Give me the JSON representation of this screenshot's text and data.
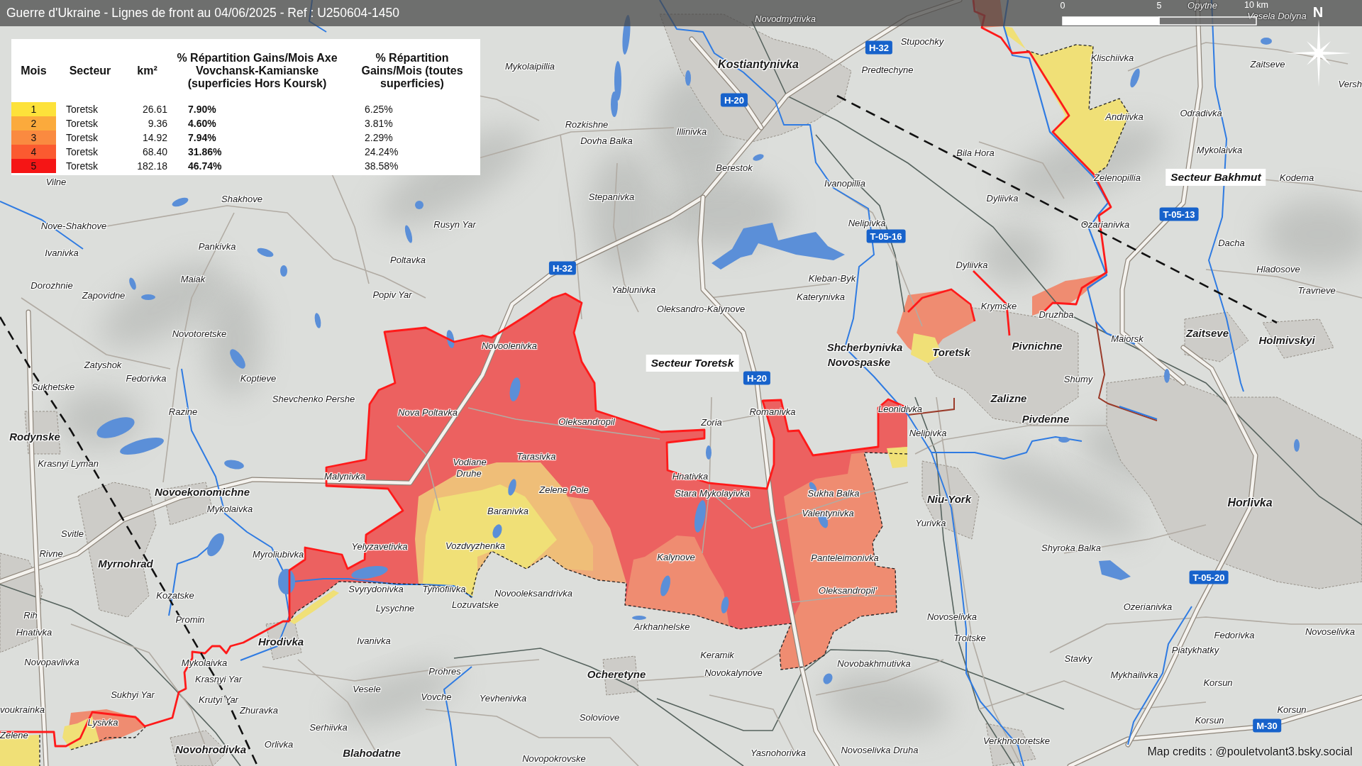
{
  "header": {
    "title": "Guerre d'Ukraine - Lignes de front au 04/06/2025 - Ref : U250604-1450"
  },
  "scale_bar": {
    "ticks": [
      "0",
      "5",
      "10 km"
    ]
  },
  "compass": {
    "label": "N"
  },
  "legend": {
    "columns": [
      "Mois",
      "Secteur",
      "km²",
      "% Répartition Gains/Mois Axe Vovchansk-Kamianske (superficies Hors Koursk)",
      "% Répartition Gains/Mois (toutes superficies)"
    ],
    "rows": [
      {
        "month": "1",
        "color": "#fde23a",
        "sector": "Toretsk",
        "area": "26.61",
        "share_axis": "7.90%",
        "share_all": "6.25%"
      },
      {
        "month": "2",
        "color": "#fbaa3c",
        "sector": "Toretsk",
        "area": "9.36",
        "share_axis": "4.60%",
        "share_all": "3.81%"
      },
      {
        "month": "3",
        "color": "#fa8a40",
        "sector": "Toretsk",
        "area": "14.92",
        "share_axis": "7.94%",
        "share_all": "2.29%"
      },
      {
        "month": "4",
        "color": "#fb5a30",
        "sector": "Toretsk",
        "area": "68.40",
        "share_axis": "31.86%",
        "share_all": "24.24%"
      },
      {
        "month": "5",
        "color": "#f51515",
        "sector": "Toretsk",
        "area": "182.18",
        "share_axis": "46.74%",
        "share_all": "38.58%"
      }
    ]
  },
  "sectors": [
    {
      "label": "Secteur Bakhmut"
    },
    {
      "label": "Secteur Toretsk"
    }
  ],
  "road_signs": [
    {
      "label": "H-32"
    },
    {
      "label": "H-20"
    },
    {
      "label": "T-05-13"
    },
    {
      "label": "T-05-16"
    },
    {
      "label": "H-32"
    },
    {
      "label": "H-20"
    },
    {
      "label": "T-05-20"
    },
    {
      "label": "M-30"
    }
  ],
  "places": [
    {
      "name": "Novodmytrivka",
      "kind": "village"
    },
    {
      "name": "Opytne",
      "kind": "village"
    },
    {
      "name": "Vesela Dolyna",
      "kind": "village"
    },
    {
      "name": "Stupochky",
      "kind": "village"
    },
    {
      "name": "Mykolaipillia",
      "kind": "village"
    },
    {
      "name": "Kostiantynivka",
      "kind": "city"
    },
    {
      "name": "Predtechyne",
      "kind": "village"
    },
    {
      "name": "Klischiivka",
      "kind": "village"
    },
    {
      "name": "Zaitseve",
      "kind": "village"
    },
    {
      "name": "Versh",
      "kind": "village"
    },
    {
      "name": "Andriivka",
      "kind": "village"
    },
    {
      "name": "Odradivka",
      "kind": "village"
    },
    {
      "name": "Rozkishne",
      "kind": "village"
    },
    {
      "name": "Dovha Balka",
      "kind": "village"
    },
    {
      "name": "Illinivka",
      "kind": "village"
    },
    {
      "name": "Bila Hora",
      "kind": "village"
    },
    {
      "name": "Mykolaivka",
      "kind": "village"
    },
    {
      "name": "Vilne",
      "kind": "village"
    },
    {
      "name": "Berestok",
      "kind": "village"
    },
    {
      "name": "Ivanopillia",
      "kind": "village"
    },
    {
      "name": "Zelenopillia",
      "kind": "village"
    },
    {
      "name": "Kodema",
      "kind": "village"
    },
    {
      "name": "Shakhove",
      "kind": "village"
    },
    {
      "name": "Stepanivka",
      "kind": "village"
    },
    {
      "name": "Dyliivka",
      "kind": "village"
    },
    {
      "name": "Nove-Shakhove",
      "kind": "village"
    },
    {
      "name": "Rusyn Yar",
      "kind": "village"
    },
    {
      "name": "Nelipivka",
      "kind": "village"
    },
    {
      "name": "Ozarianivka",
      "kind": "village"
    },
    {
      "name": "Ivanivka",
      "kind": "village"
    },
    {
      "name": "Pankivka",
      "kind": "village"
    },
    {
      "name": "Dacha",
      "kind": "village"
    },
    {
      "name": "Poltavka",
      "kind": "village"
    },
    {
      "name": "Dyliivka",
      "kind": "village"
    },
    {
      "name": "Hladosove",
      "kind": "village"
    },
    {
      "name": "Dorozhnie",
      "kind": "village"
    },
    {
      "name": "Maiak",
      "kind": "village"
    },
    {
      "name": "Kleban-Byk",
      "kind": "village"
    },
    {
      "name": "Zapovidne",
      "kind": "village"
    },
    {
      "name": "Popiv Yar",
      "kind": "village"
    },
    {
      "name": "Yablunivka",
      "kind": "village"
    },
    {
      "name": "Katerynivka",
      "kind": "village"
    },
    {
      "name": "Travneve",
      "kind": "village"
    },
    {
      "name": "Oleksandro-Kalynove",
      "kind": "village"
    },
    {
      "name": "Krymske",
      "kind": "village"
    },
    {
      "name": "Druzhba",
      "kind": "village"
    },
    {
      "name": "Novotoretske",
      "kind": "village"
    },
    {
      "name": "Novoolenivka",
      "kind": "village"
    },
    {
      "name": "Shcherbynivka",
      "kind": "town"
    },
    {
      "name": "Toretsk",
      "kind": "town"
    },
    {
      "name": "Pivnichne",
      "kind": "town"
    },
    {
      "name": "Maiorsk",
      "kind": "village"
    },
    {
      "name": "Zaitseve",
      "kind": "town"
    },
    {
      "name": "Holmivskyi",
      "kind": "town"
    },
    {
      "name": "Zatyshok",
      "kind": "village"
    },
    {
      "name": "Novospaske",
      "kind": "town"
    },
    {
      "name": "Sukhetske",
      "kind": "village"
    },
    {
      "name": "Fedorivka",
      "kind": "village"
    },
    {
      "name": "Koptieve",
      "kind": "village"
    },
    {
      "name": "Shumy",
      "kind": "village"
    },
    {
      "name": "Shevchenko Pershe",
      "kind": "village"
    },
    {
      "name": "Zalizne",
      "kind": "town"
    },
    {
      "name": "Razine",
      "kind": "village"
    },
    {
      "name": "Nova Poltavka",
      "kind": "village"
    },
    {
      "name": "Oleksandropil",
      "kind": "village"
    },
    {
      "name": "Zoria",
      "kind": "village"
    },
    {
      "name": "Romanivka",
      "kind": "village"
    },
    {
      "name": "Leonidivka",
      "kind": "village"
    },
    {
      "name": "Pivdenne",
      "kind": "town"
    },
    {
      "name": "Rodynske",
      "kind": "town"
    },
    {
      "name": "Nelipivka",
      "kind": "village"
    },
    {
      "name": "Krasnyi Lyman",
      "kind": "village"
    },
    {
      "name": "Vodiane",
      "kind": "village"
    },
    {
      "name": "Tarasivka",
      "kind": "village"
    },
    {
      "name": "Malynivka",
      "kind": "village"
    },
    {
      "name": "Druhe",
      "kind": "village"
    },
    {
      "name": "Hnativka",
      "kind": "village"
    },
    {
      "name": "Novoekonomichne",
      "kind": "town"
    },
    {
      "name": "Mykolaivka",
      "kind": "village"
    },
    {
      "name": "Baranivka",
      "kind": "village"
    },
    {
      "name": "Zelene Pole",
      "kind": "village"
    },
    {
      "name": "Stara Mykolayivka",
      "kind": "village"
    },
    {
      "name": "Sukha Balka",
      "kind": "village"
    },
    {
      "name": "Valentynivka",
      "kind": "village"
    },
    {
      "name": "Niu-York",
      "kind": "town"
    },
    {
      "name": "Horlivka",
      "kind": "city"
    },
    {
      "name": "Yurivka",
      "kind": "village"
    },
    {
      "name": "Svitle",
      "kind": "village"
    },
    {
      "name": "Rivne",
      "kind": "village"
    },
    {
      "name": "Myrnohrad",
      "kind": "town"
    },
    {
      "name": "Myroliubivka",
      "kind": "village"
    },
    {
      "name": "Yelyzavetivka",
      "kind": "village"
    },
    {
      "name": "Vozdvyzhenka",
      "kind": "village"
    },
    {
      "name": "Kalynove",
      "kind": "village"
    },
    {
      "name": "Panteleimonivka",
      "kind": "village"
    },
    {
      "name": "Shyroka Balka",
      "kind": "village"
    },
    {
      "name": "Kozatske",
      "kind": "village"
    },
    {
      "name": "Svyrydonivka",
      "kind": "village"
    },
    {
      "name": "Tymofiivka",
      "kind": "village"
    },
    {
      "name": "Novooleksandrivka",
      "kind": "village"
    },
    {
      "name": "Oleksandropil'",
      "kind": "village"
    },
    {
      "name": "Rih",
      "kind": "village"
    },
    {
      "name": "Promin",
      "kind": "village"
    },
    {
      "name": "Lysychne",
      "kind": "village"
    },
    {
      "name": "Lozuvatske",
      "kind": "village"
    },
    {
      "name": "Novoselivka",
      "kind": "village"
    },
    {
      "name": "Ozerianivka",
      "kind": "village"
    },
    {
      "name": "Hnativka",
      "kind": "village"
    },
    {
      "name": "Hrodivka",
      "kind": "town"
    },
    {
      "name": "Ivanivka",
      "kind": "village"
    },
    {
      "name": "Arkhanhelske",
      "kind": "village"
    },
    {
      "name": "Troitske",
      "kind": "village"
    },
    {
      "name": "Fedorivka",
      "kind": "village"
    },
    {
      "name": "Novoselivka",
      "kind": "village"
    },
    {
      "name": "Novopavlivka",
      "kind": "village"
    },
    {
      "name": "Mykolaivka",
      "kind": "village"
    },
    {
      "name": "Keramik",
      "kind": "village"
    },
    {
      "name": "Novobakhmutivka",
      "kind": "village"
    },
    {
      "name": "Stavky",
      "kind": "village"
    },
    {
      "name": "Piatykhatky",
      "kind": "village"
    },
    {
      "name": "Krasnyi Yar",
      "kind": "village"
    },
    {
      "name": "Prohres",
      "kind": "village"
    },
    {
      "name": "Ocheretyne",
      "kind": "town"
    },
    {
      "name": "Novokalynove",
      "kind": "village"
    },
    {
      "name": "Mykhailivka",
      "kind": "village"
    },
    {
      "name": "Korsun",
      "kind": "village"
    },
    {
      "name": "Sukhyi Yar",
      "kind": "village"
    },
    {
      "name": "Krutyi Yar",
      "kind": "village"
    },
    {
      "name": "Vesele",
      "kind": "village"
    },
    {
      "name": "Vovche",
      "kind": "village"
    },
    {
      "name": "Yevhenivka",
      "kind": "village"
    },
    {
      "name": "voukrainka",
      "kind": "village"
    },
    {
      "name": "Lysivka",
      "kind": "village"
    },
    {
      "name": "Zhuravka",
      "kind": "village"
    },
    {
      "name": "Serhiivka",
      "kind": "village"
    },
    {
      "name": "Soloviove",
      "kind": "village"
    },
    {
      "name": "Korsun",
      "kind": "village"
    },
    {
      "name": "Korsun",
      "kind": "village"
    },
    {
      "name": "Zelene",
      "kind": "village"
    },
    {
      "name": "Novohrodivka",
      "kind": "town"
    },
    {
      "name": "Orlivka",
      "kind": "village"
    },
    {
      "name": "Blahodatne",
      "kind": "town"
    },
    {
      "name": "Novopokrovske",
      "kind": "village"
    },
    {
      "name": "Yasnohorivka",
      "kind": "village"
    },
    {
      "name": "Novoselivka Druha",
      "kind": "village"
    },
    {
      "name": "Verkhnotoretske",
      "kind": "village"
    }
  ],
  "credits": "Map credits : @pouletvolant3.bsky.social"
}
